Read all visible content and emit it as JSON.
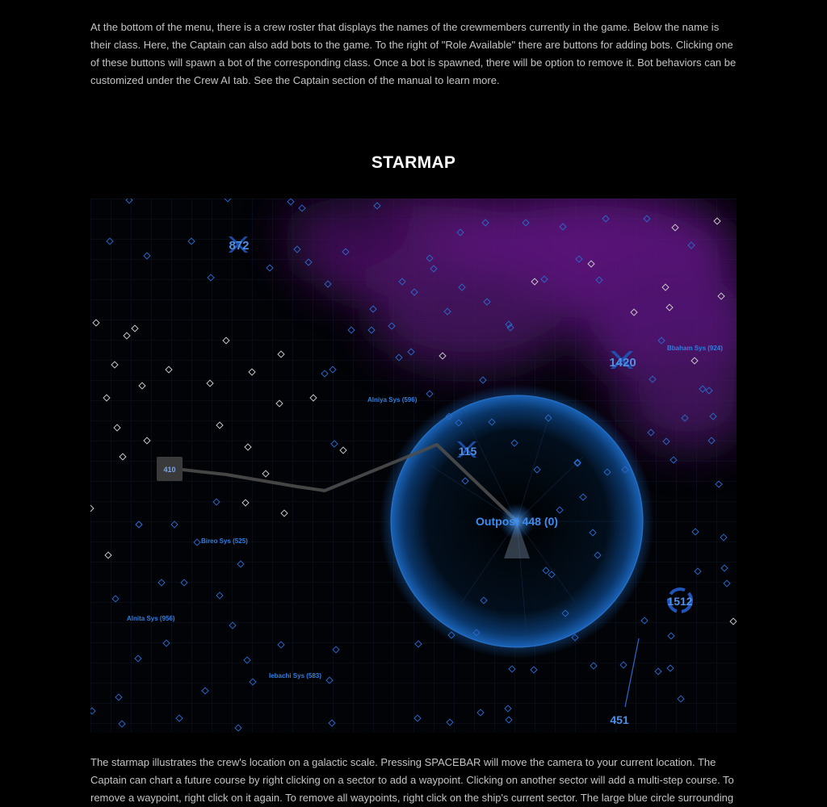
{
  "intro_paragraph": "At the bottom of the menu, there is a crew roster that displays the names of the crewmembers currently in the game. Below the name is their class. Here, the Captain can also add bots to the game. To the right of \"Role Available\" there are buttons for adding bots. Clicking one of these buttons will spawn a bot of the corresponding class. Once a bot is spawned, there will be option to remove it. Bot behaviors can be customized under the Crew AI tab. See the Captain section of the manual to learn more.",
  "section_title": "STARMAP",
  "starmap": {
    "current_sector_label": "Outpost 448 (0)",
    "sector_numbers": [
      "872",
      "1420",
      "115",
      "410",
      "1512",
      "451"
    ],
    "system_labels": [
      "Bbaham Sys (924)",
      "Alniya Sys (596)",
      "Bireo Sys (525)",
      "Alnita Sys (956)",
      "Iebachi Sys (583)"
    ],
    "colors": {
      "background": "#020307",
      "nebula": "#6a1a86",
      "range_circle": "#1a5fb0",
      "label_blue": "#2f7fe0",
      "sector_blue": "#2a67c8",
      "sector_white": "#c8c8c8",
      "course_line": "#5a5a5a"
    },
    "icons": [
      "sector-diamond-icon",
      "faction-emblem-icon",
      "ship-marker-icon"
    ]
  },
  "description_paragraph": "The starmap illustrates the crew's location on a galactic scale. Pressing SPACEBAR will move the camera to your current location. The Captain can chart a future course by right clicking on a sector to add a waypoint. Clicking on another sector will add a multi-step course. To remove a waypoint, right click on it again. To remove all waypoints, right click on the ship's current sector. The large blue circle surrounding"
}
